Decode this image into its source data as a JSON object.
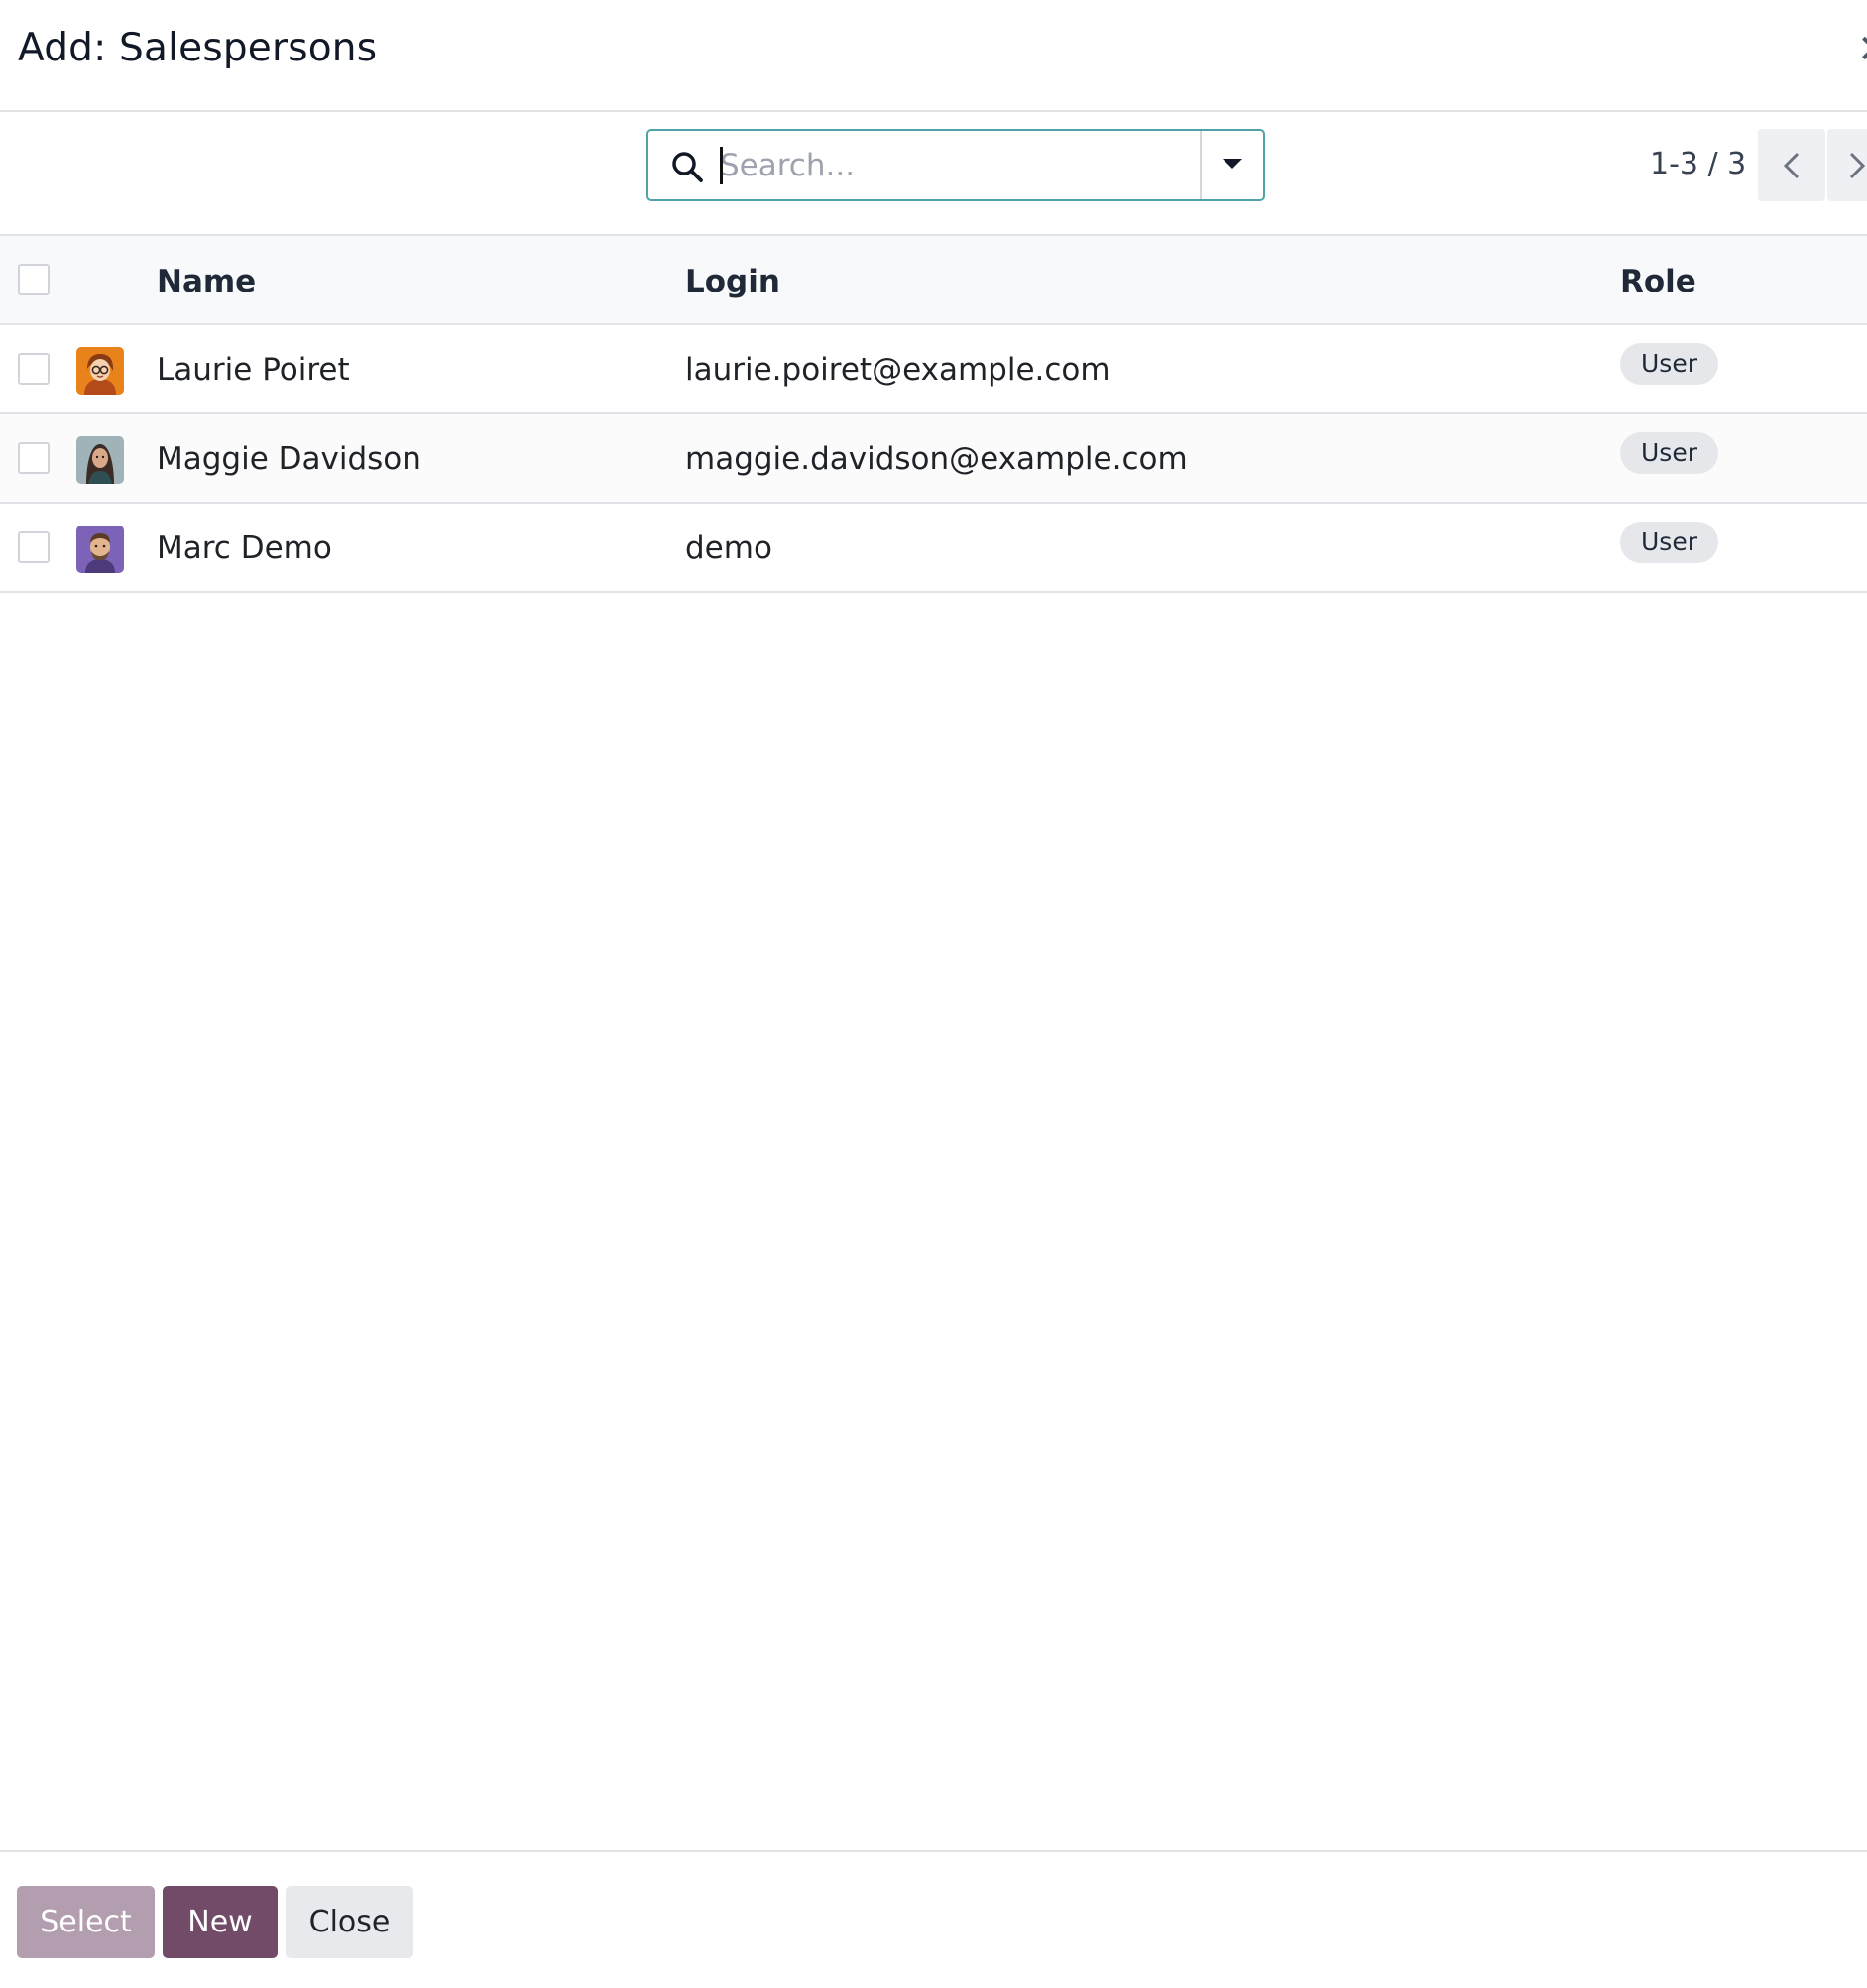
{
  "dialog": {
    "title": "Add: Salespersons",
    "close_glyph": "✕"
  },
  "search": {
    "placeholder": "Search...",
    "value": ""
  },
  "pager": {
    "value": "1-3 / 3"
  },
  "table": {
    "columns": {
      "name": "Name",
      "login": "Login",
      "role": "Role"
    },
    "rows": [
      {
        "name": "Laurie Poiret",
        "login": "laurie.poiret@example.com",
        "role": "User",
        "avatar_icon": "avatar-laurie"
      },
      {
        "name": "Maggie Davidson",
        "login": "maggie.davidson@example.com",
        "role": "User",
        "avatar_icon": "avatar-maggie"
      },
      {
        "name": "Marc Demo",
        "login": "demo",
        "role": "User",
        "avatar_icon": "avatar-marc"
      }
    ]
  },
  "footer": {
    "select_label": "Select",
    "new_label": "New",
    "close_label": "Close"
  },
  "colors": {
    "primary": "#714b67",
    "primary_disabled": "#b39eb0",
    "focus_border": "#4fa3a8"
  }
}
